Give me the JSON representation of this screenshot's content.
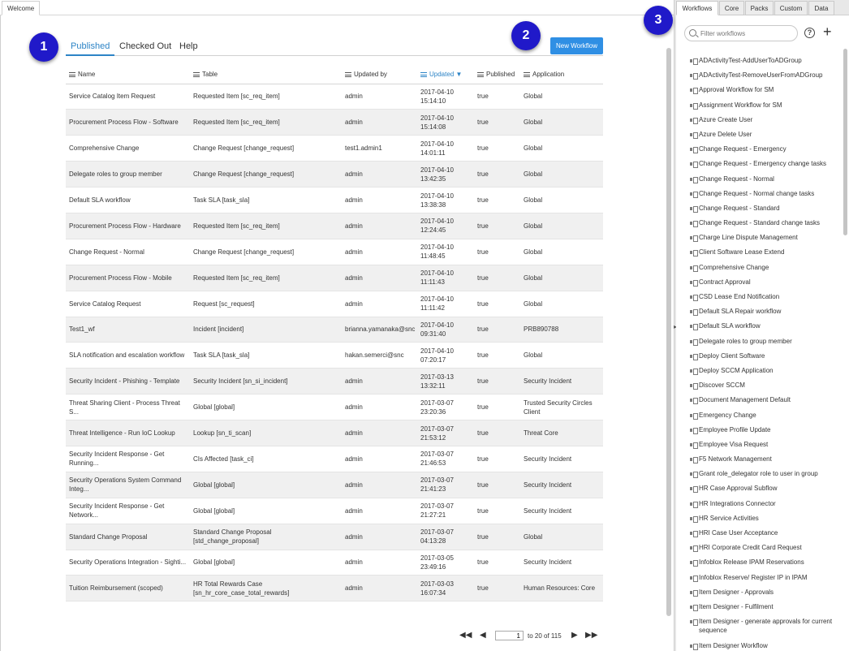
{
  "top_tab": {
    "label": "Welcome"
  },
  "main": {
    "tabs": [
      {
        "label": "Published",
        "active": true
      },
      {
        "label": "Checked Out",
        "active": false
      },
      {
        "label": "Help",
        "active": false
      }
    ],
    "new_button": "New Workflow",
    "columns": [
      "Name",
      "Table",
      "Updated by",
      "Updated",
      "Published",
      "Application"
    ],
    "sorted_column": "Updated",
    "sort_direction": "descending",
    "rows": [
      {
        "name": "Service Catalog Item Request",
        "table": "Requested Item [sc_req_item]",
        "updated_by": "admin",
        "updated_date": "2017-04-10",
        "updated_time": "15:14:10",
        "published": "true",
        "application": "Global"
      },
      {
        "name": "Procurement Process Flow - Software",
        "table": "Requested Item [sc_req_item]",
        "updated_by": "admin",
        "updated_date": "2017-04-10",
        "updated_time": "15:14:08",
        "published": "true",
        "application": "Global"
      },
      {
        "name": "Comprehensive Change",
        "table": "Change Request [change_request]",
        "updated_by": "test1.admin1",
        "updated_date": "2017-04-10",
        "updated_time": "14:01:11",
        "published": "true",
        "application": "Global"
      },
      {
        "name": "Delegate roles to group member",
        "table": "Change Request [change_request]",
        "updated_by": "admin",
        "updated_date": "2017-04-10",
        "updated_time": "13:42:35",
        "published": "true",
        "application": "Global"
      },
      {
        "name": "Default SLA workflow",
        "table": "Task SLA [task_sla]",
        "updated_by": "admin",
        "updated_date": "2017-04-10",
        "updated_time": "13:38:38",
        "published": "true",
        "application": "Global"
      },
      {
        "name": "Procurement Process Flow - Hardware",
        "table": "Requested Item [sc_req_item]",
        "updated_by": "admin",
        "updated_date": "2017-04-10",
        "updated_time": "12:24:45",
        "published": "true",
        "application": "Global"
      },
      {
        "name": "Change Request - Normal",
        "table": "Change Request [change_request]",
        "updated_by": "admin",
        "updated_date": "2017-04-10",
        "updated_time": "11:48:45",
        "published": "true",
        "application": "Global"
      },
      {
        "name": "Procurement Process Flow - Mobile",
        "table": "Requested Item [sc_req_item]",
        "updated_by": "admin",
        "updated_date": "2017-04-10",
        "updated_time": "11:11:43",
        "published": "true",
        "application": "Global"
      },
      {
        "name": "Service Catalog Request",
        "table": "Request [sc_request]",
        "updated_by": "admin",
        "updated_date": "2017-04-10",
        "updated_time": "11:11:42",
        "published": "true",
        "application": "Global"
      },
      {
        "name": "Test1_wf",
        "table": "Incident [incident]",
        "updated_by": "brianna.yamanaka@snc",
        "updated_date": "2017-04-10",
        "updated_time": "09:31:40",
        "published": "true",
        "application": "PRB890788"
      },
      {
        "name": "SLA notification and escalation workflow",
        "table": "Task SLA [task_sla]",
        "updated_by": "hakan.semerci@snc",
        "updated_date": "2017-04-10",
        "updated_time": "07:20:17",
        "published": "true",
        "application": "Global"
      },
      {
        "name": "Security Incident - Phishing - Template",
        "table": "Security Incident [sn_si_incident]",
        "updated_by": "admin",
        "updated_date": "2017-03-13",
        "updated_time": "13:32:11",
        "published": "true",
        "application": "Security Incident"
      },
      {
        "name": "Threat Sharing Client - Process Threat S...",
        "table": "Global [global]",
        "updated_by": "admin",
        "updated_date": "2017-03-07",
        "updated_time": "23:20:36",
        "published": "true",
        "application": "Trusted Security Circles Client"
      },
      {
        "name": "Threat Intelligence - Run IoC Lookup",
        "table": "Lookup [sn_ti_scan]",
        "updated_by": "admin",
        "updated_date": "2017-03-07",
        "updated_time": "21:53:12",
        "published": "true",
        "application": "Threat Core"
      },
      {
        "name": "Security Incident Response - Get Running...",
        "table": "CIs Affected [task_ci]",
        "updated_by": "admin",
        "updated_date": "2017-03-07",
        "updated_time": "21:46:53",
        "published": "true",
        "application": "Security Incident"
      },
      {
        "name": "Security Operations System Command Integ...",
        "table": "Global [global]",
        "updated_by": "admin",
        "updated_date": "2017-03-07",
        "updated_time": "21:41:23",
        "published": "true",
        "application": "Security Incident"
      },
      {
        "name": "Security Incident Response - Get Network...",
        "table": "Global [global]",
        "updated_by": "admin",
        "updated_date": "2017-03-07",
        "updated_time": "21:27:21",
        "published": "true",
        "application": "Security Incident"
      },
      {
        "name": "Standard Change Proposal",
        "table": "Standard Change Proposal [std_change_proposal]",
        "updated_by": "admin",
        "updated_date": "2017-03-07",
        "updated_time": "04:13:28",
        "published": "true",
        "application": "Global"
      },
      {
        "name": "Security Operations Integration - Sighti...",
        "table": "Global [global]",
        "updated_by": "admin",
        "updated_date": "2017-03-05",
        "updated_time": "23:49:16",
        "published": "true",
        "application": "Security Incident"
      },
      {
        "name": "Tuition Reimbursement (scoped)",
        "table": "HR Total Rewards Case [sn_hr_core_case_total_rewards]",
        "updated_by": "admin",
        "updated_date": "2017-03-03",
        "updated_time": "16:07:34",
        "published": "true",
        "application": "Human Resources: Core"
      }
    ],
    "pagination": {
      "current_page": "1",
      "range_text": "to 20 of 115"
    }
  },
  "badges": [
    "1",
    "2",
    "3"
  ],
  "panel": {
    "tabs": [
      {
        "label": "Workflows",
        "active": true
      },
      {
        "label": "Core",
        "active": false
      },
      {
        "label": "Packs",
        "active": false
      },
      {
        "label": "Custom",
        "active": false
      },
      {
        "label": "Data",
        "active": false
      }
    ],
    "search_placeholder": "Filter workflows",
    "help_glyph": "?",
    "plus_glyph": "+",
    "items": [
      "ADActivityTest-AddUserToADGroup",
      "ADActivityTest-RemoveUserFromADGroup",
      "Approval Workflow for SM",
      "Assignment Workflow for SM",
      "Azure Create User",
      "Azure Delete User",
      "Change Request - Emergency",
      "Change Request - Emergency change tasks",
      "Change Request - Normal",
      "Change Request - Normal change tasks",
      "Change Request - Standard",
      "Change Request - Standard change tasks",
      "Charge Line Dispute Management",
      "Client Software Lease Extend",
      "Comprehensive Change",
      "Contract Approval",
      "CSD Lease End Notification",
      "Default SLA Repair workflow",
      "Default SLA workflow",
      "Delegate roles to group member",
      "Deploy Client Software",
      "Deploy SCCM Application",
      "Discover SCCM",
      "Document Management Default",
      "Emergency Change",
      "Employee Profile Update",
      "Employee Visa Request",
      "F5 Network Management",
      "Grant role_delegator role to user in group",
      "HR Case Approval Subflow",
      "HR Integrations Connector",
      "HR Service Activities",
      "HRI Case User Acceptance",
      "HRI Corporate Credit Card Request",
      "Infoblox Release IPAM Reservations",
      "Infoblox Reserve/ Register IP in IPAM",
      "Item Designer - Approvals",
      "Item Designer - Fulfilment",
      "Item Designer - generate approvals for current sequence",
      "Item Designer Workflow"
    ]
  },
  "colors": {
    "accent": "#2d84c6",
    "button": "#2f8fe4",
    "badge": "#2019c9",
    "row_alt": "#f0f0f0"
  }
}
